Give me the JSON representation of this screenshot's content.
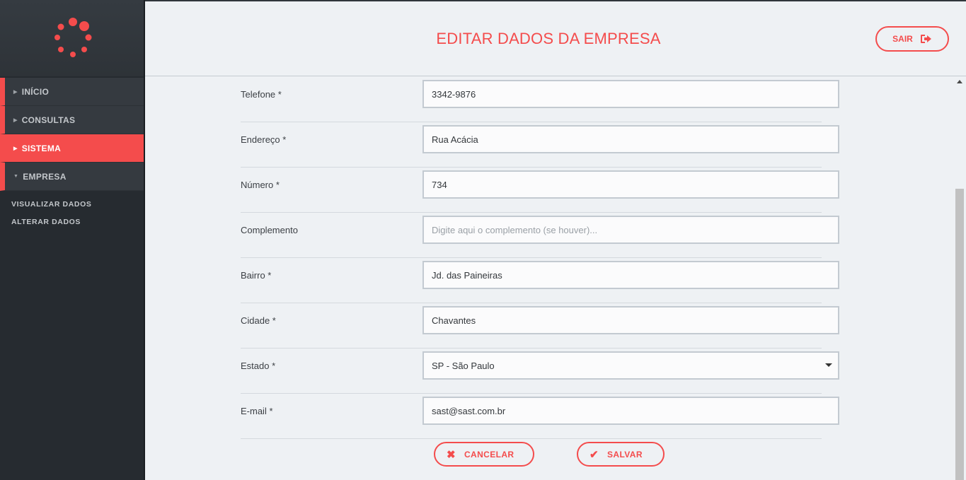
{
  "colors": {
    "accent": "#f44c4c",
    "sidebar_bg": "#262b30",
    "nav_bg": "#353a40",
    "page_bg": "#eef1f4"
  },
  "sidebar": {
    "logo_icon": "dots-spinner-logo",
    "items": [
      {
        "label": "INÍCIO",
        "active": false,
        "expanded": false
      },
      {
        "label": "CONSULTAS",
        "active": false,
        "expanded": false
      },
      {
        "label": "SISTEMA",
        "active": true,
        "expanded": false
      },
      {
        "label": "EMPRESA",
        "active": false,
        "expanded": true
      }
    ],
    "subitems": [
      {
        "label": "VISUALIZAR DADOS"
      },
      {
        "label": "ALTERAR DADOS"
      }
    ]
  },
  "header": {
    "title": "EDITAR DADOS DA EMPRESA",
    "logout_label": "SAIR",
    "logout_icon": "sign-out-icon"
  },
  "form": {
    "fields": [
      {
        "label": "Telefone  *",
        "value": "3342-9876",
        "placeholder": ""
      },
      {
        "label": "Endereço  *",
        "value": "Rua Acácia",
        "placeholder": ""
      },
      {
        "label": "Número  *",
        "value": "734",
        "placeholder": ""
      },
      {
        "label": "Complemento",
        "value": "",
        "placeholder": "Digite aqui o complemento (se houver)..."
      },
      {
        "label": "Bairro  *",
        "value": "Jd. das Paineiras",
        "placeholder": ""
      },
      {
        "label": "Cidade  *",
        "value": "Chavantes",
        "placeholder": ""
      },
      {
        "label": "Estado   *",
        "value": "SP - São Paulo",
        "type": "select"
      },
      {
        "label": "E-mail  *",
        "value": "sast@sast.com.br",
        "placeholder": ""
      }
    ]
  },
  "actions": {
    "cancel_label": "CANCELAR",
    "cancel_icon": "times-icon",
    "save_label": "SALVAR",
    "save_icon": "check-icon"
  }
}
